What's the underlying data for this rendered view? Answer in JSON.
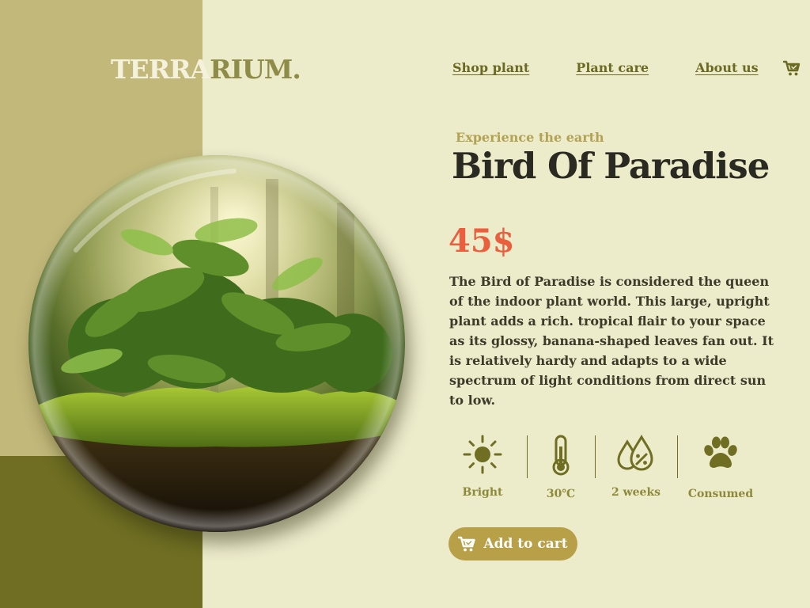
{
  "brand": {
    "logo_part1": "TERRA",
    "logo_part2": "RIUM."
  },
  "nav": {
    "items": [
      {
        "label": "Shop plant"
      },
      {
        "label": "Plant care"
      },
      {
        "label": "About us"
      }
    ],
    "cart_icon": "cart-icon"
  },
  "product": {
    "eyebrow": "Experience the earth",
    "title": "Bird Of Paradise",
    "price": "45$",
    "description": "The Bird of Paradise is considered the queen of the indoor plant world. This large, upright plant adds a rich. tropical flair to your space as its glossy, banana-shaped leaves fan out. It is relatively hardy and adapts to a wide spectrum of light conditions from direct sun to low.",
    "image": "terrarium-sphere-image"
  },
  "features": [
    {
      "icon": "sun-icon",
      "label": "Bright"
    },
    {
      "icon": "thermometer-icon",
      "label": "30℃"
    },
    {
      "icon": "water-drops-icon",
      "label": "2 weeks"
    },
    {
      "icon": "paw-icon",
      "label": "Consumed"
    }
  ],
  "cta": {
    "label": "Add to cart",
    "icon": "cart-icon"
  },
  "colors": {
    "background": "#ecebca",
    "khaki": "#c2b87a",
    "olive": "#6f6e23",
    "accent_price": "#ea5f3e",
    "button": "#b8a049"
  }
}
